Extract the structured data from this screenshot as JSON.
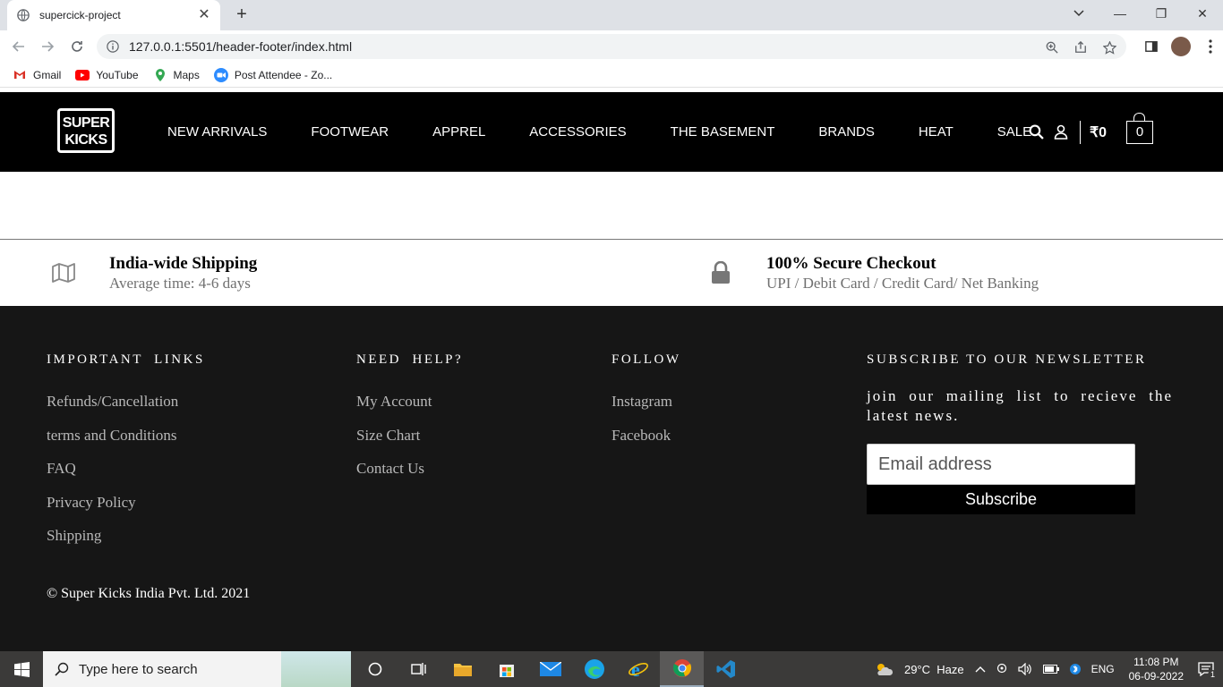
{
  "browser": {
    "tab_title": "supercick-project",
    "url": "127.0.0.1:5501/header-footer/index.html",
    "bookmarks": [
      {
        "label": "Gmail",
        "icon": "gmail-icon"
      },
      {
        "label": "YouTube",
        "icon": "youtube-icon"
      },
      {
        "label": "Maps",
        "icon": "maps-icon"
      },
      {
        "label": "Post Attendee - Zo...",
        "icon": "zoom-icon"
      }
    ]
  },
  "header": {
    "logo_line1": "SUPER",
    "logo_line2": "KICKS",
    "nav": [
      "NEW ARRIVALS",
      "FOOTWEAR",
      "APPREL",
      "ACCESSORIES",
      "THE BASEMENT",
      "BRANDS",
      "HEAT",
      "SALE"
    ],
    "price": "₹0",
    "cart_count": "0"
  },
  "features": [
    {
      "icon": "map-icon",
      "title": "India-wide Shipping",
      "subtitle": "Average time: 4-6 days"
    },
    {
      "icon": "lock-icon",
      "title": "100% Secure Checkout",
      "subtitle": "UPI / Debit Card / Credit Card/ Net Banking"
    }
  ],
  "footer": {
    "important_links": {
      "heading": "IMPORTANT  LINKS",
      "items": [
        "Refunds/Cancellation",
        "terms and Conditions",
        "FAQ",
        "Privacy Policy",
        "Shipping"
      ]
    },
    "need_help": {
      "heading": "NEED  HELP?",
      "items": [
        "My Account",
        "Size Chart",
        "Contact Us"
      ]
    },
    "follow": {
      "heading": "FOLLOW",
      "items": [
        "Instagram",
        "Facebook"
      ]
    },
    "newsletter": {
      "heading": "SUBSCRIBE TO OUR NEWSLETTER",
      "text": "join our mailing list to recieve the latest news.",
      "placeholder": "Email address",
      "button": "Subscribe"
    },
    "copyright": "© Super Kicks India Pvt. Ltd. 2021"
  },
  "taskbar": {
    "search_placeholder": "Type here to search",
    "weather": "29°C  Haze",
    "language": "ENG",
    "time": "11:08 PM",
    "date": "06-09-2022",
    "notifications": "1"
  }
}
